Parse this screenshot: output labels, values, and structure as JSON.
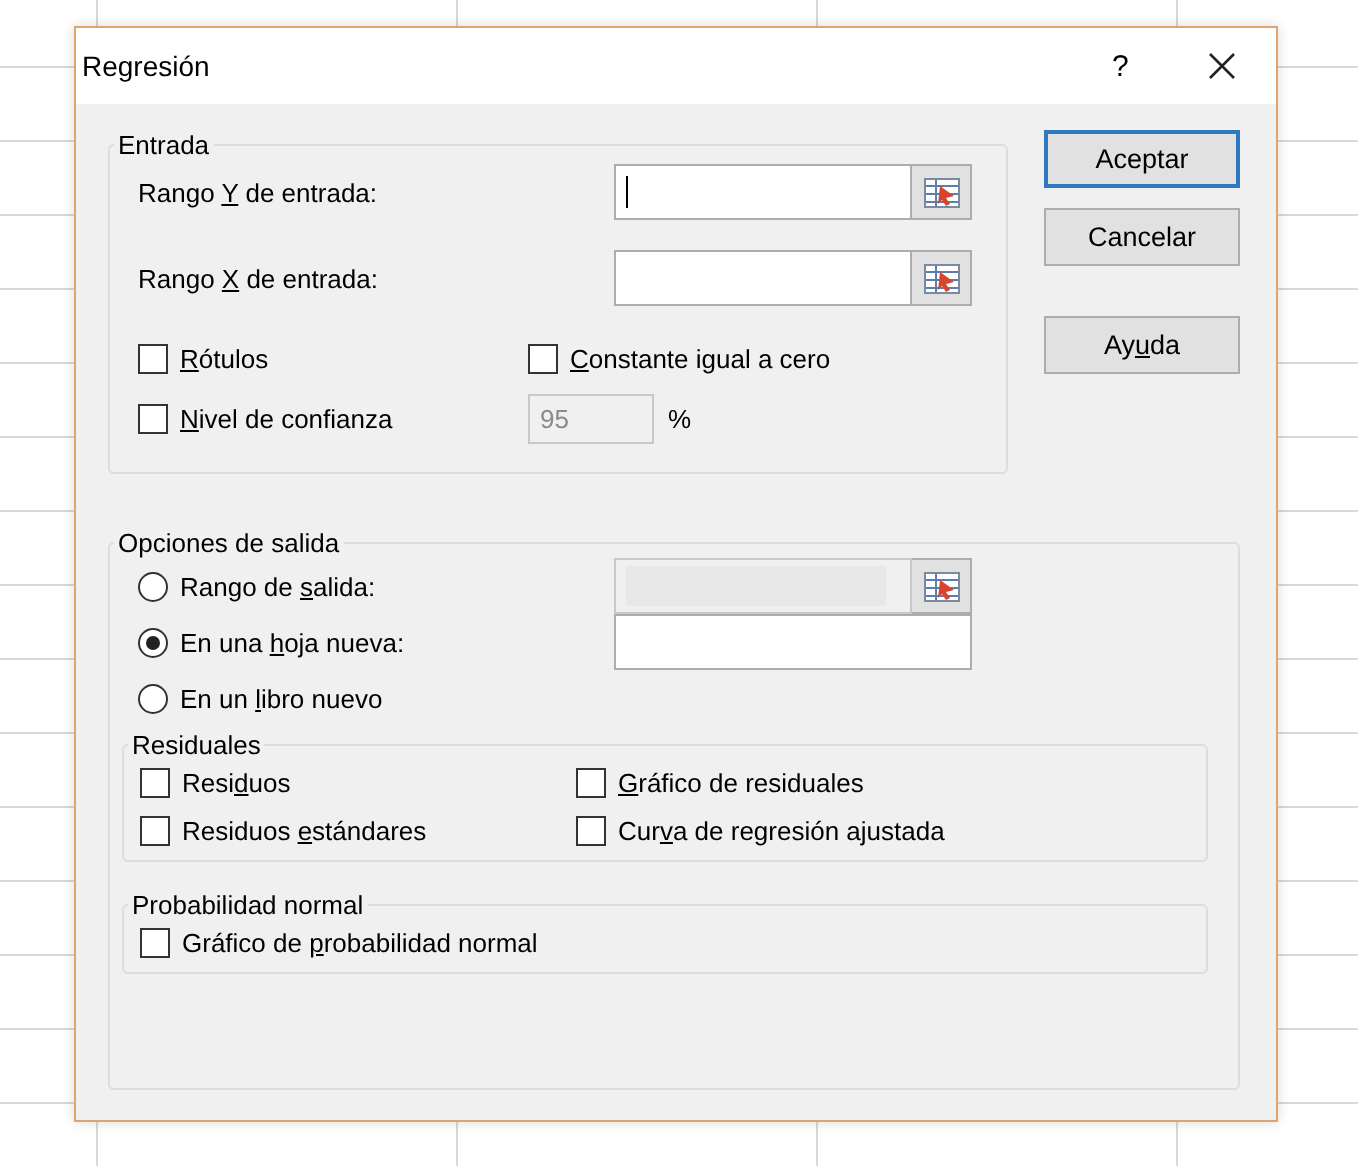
{
  "window": {
    "title": "Regresión",
    "help": "?"
  },
  "input_group": {
    "title": "Entrada",
    "ranges": [
      {
        "label": {
          "pre": "Rango ",
          "key": "Y",
          "post": " de entrada:"
        },
        "focused": true
      },
      {
        "label": {
          "pre": "Rango ",
          "key": "X",
          "post": " de entrada:"
        },
        "focused": false
      }
    ],
    "options": [
      {
        "label": {
          "key": "R",
          "post": "ótulos"
        },
        "checked": false
      },
      {
        "label": {
          "key": "C",
          "post": "onstante igual a cero"
        },
        "checked": false
      },
      {
        "label": {
          "key": "N",
          "post": "ivel de confianza"
        },
        "checked": false
      }
    ],
    "confidence": {
      "value": "95",
      "unit": "%",
      "disabled": true
    }
  },
  "buttons": [
    {
      "label": {
        "post": "Aceptar"
      },
      "default": true
    },
    {
      "label": {
        "post": "Cancelar"
      },
      "default": false
    },
    {
      "label": {
        "pre": "Ay",
        "key": "u",
        "post": "da"
      },
      "default": false
    }
  ],
  "output_group": {
    "title": "Opciones de salida",
    "destinations": [
      {
        "label": {
          "pre": "Rango de ",
          "key": "s",
          "post": "alida:"
        },
        "selected": false,
        "field": {
          "kind": "range",
          "disabled": true
        }
      },
      {
        "label": {
          "pre": "En una ",
          "key": "h",
          "post": "oja nueva:"
        },
        "selected": true,
        "field": {
          "kind": "text",
          "disabled": false
        }
      },
      {
        "label": {
          "pre": "En un ",
          "key": "l",
          "post": "ibro nuevo"
        },
        "selected": false
      }
    ],
    "residuals": {
      "title": "Residuales",
      "options": [
        {
          "label": {
            "pre": "Resi",
            "key": "d",
            "post": "uos"
          },
          "checked": false
        },
        {
          "label": {
            "key": "G",
            "post": "ráfico de residuales"
          },
          "checked": false
        },
        {
          "label": {
            "pre": "Residuos ",
            "key": "e",
            "post": "stándares"
          },
          "checked": false
        },
        {
          "label": {
            "pre": "Cur",
            "key": "v",
            "post": "a de regresión ajustada"
          },
          "checked": false
        }
      ]
    },
    "normal": {
      "title": "Probabilidad normal",
      "options": [
        {
          "label": {
            "pre": "Gráfico de ",
            "key": "p",
            "post": "robabilidad normal"
          },
          "checked": false
        }
      ]
    }
  }
}
